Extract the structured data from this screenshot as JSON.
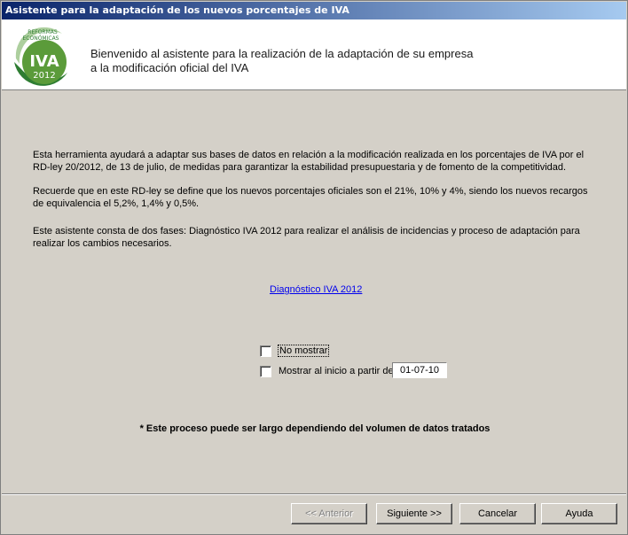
{
  "window": {
    "title": "Asistente para la adaptación de los nuevos porcentajes de IVA"
  },
  "header": {
    "welcome_line1": "Bienvenido al asistente para la realización de la adaptación de su empresa",
    "welcome_line2": "a la modificación oficial del IVA",
    "logo": {
      "top_text_1": "REFORMAS",
      "top_text_2": "ECONÓMICAS",
      "main_text": "IVA",
      "year": "2012",
      "accent": "#6aa84f"
    }
  },
  "body": {
    "para1": "Esta herramienta ayudará a adaptar sus bases de datos en relación a la modificación realizada en los porcentajes de IVA por el RD-ley 20/2012, de 13 de julio, de medidas para garantizar la estabilidad presupuestaria y de fomento de la competitividad.",
    "para2": "Recuerde que en este RD-ley se define que los nuevos porcentajes oficiales son el 21%, 10% y 4%, siendo los nuevos recargos de equivalencia el 5,2%, 1,4% y 0,5%.",
    "para3": "Este asistente consta de dos fases:  Diagnóstico IVA 2012 para realizar el análisis de incidencias y proceso de adaptación para realizar los cambios necesarios.",
    "link": "Diagnóstico IVA 2012",
    "checkbox_no_mostrar": {
      "label": "No mostrar",
      "checked": false
    },
    "checkbox_mostrar_inicio": {
      "label": "Mostrar al inicio a partir de",
      "checked": false
    },
    "date_value": "01-07-10",
    "note": "* Este proceso puede ser largo dependiendo del volumen de datos tratados"
  },
  "buttons": {
    "back": "<< Anterior",
    "next": "Siguiente >>",
    "cancel": "Cancelar",
    "help": "Ayuda"
  }
}
